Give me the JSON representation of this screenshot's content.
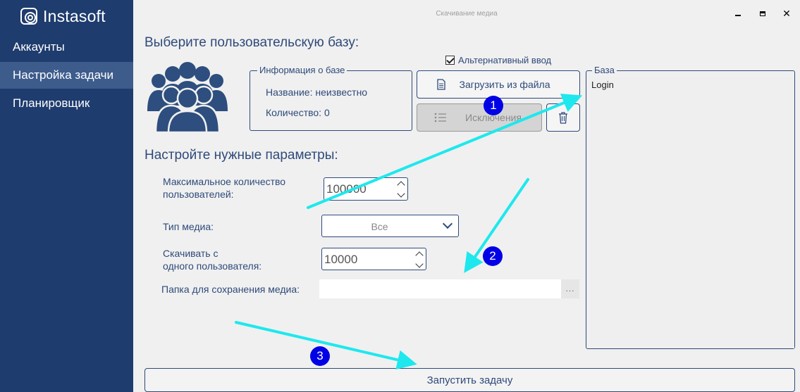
{
  "app": {
    "logo_text": "Instasoft",
    "window_title": "Скачивание медиа"
  },
  "sidebar": {
    "items": [
      {
        "label": "Аккаунты",
        "active": false
      },
      {
        "label": "Настройка задачи",
        "active": true
      },
      {
        "label": "Планировщик",
        "active": false
      }
    ]
  },
  "section1": {
    "title": "Выберите пользовательскую базу:"
  },
  "info_box": {
    "legend": "Информация о базе",
    "name_line": "Название: неизвестно",
    "count_line": "Количество: 0"
  },
  "alt_input": {
    "label": "Альтернативный ввод",
    "checked": true
  },
  "buttons": {
    "load_file": "Загрузить из файла",
    "exclusions": "Исключения",
    "run": "Запустить задачу"
  },
  "base_box": {
    "legend": "База",
    "items": [
      "Login"
    ]
  },
  "section2": {
    "title": "Настройте нужные параметры:"
  },
  "params": {
    "max_users_label": "Максимальное количество\nпользователей:",
    "max_users_value": "100000",
    "media_type_label": "Тип медиа:",
    "media_type_value": "Все",
    "per_user_label": "Скачивать с\nодного пользователя:",
    "per_user_value": "10000",
    "folder_label": "Папка для сохранения медиа:",
    "folder_value": "",
    "folder_browse": "..."
  },
  "annotations": {
    "badge_1": "1",
    "badge_2": "2",
    "badge_3": "3"
  },
  "colors": {
    "sidebar": "#1f3c6e",
    "sidebar_active": "#3d5c8c",
    "accent": "#2e4a7a",
    "arrow": "#1ee8ee",
    "badge": "#0000e6"
  }
}
